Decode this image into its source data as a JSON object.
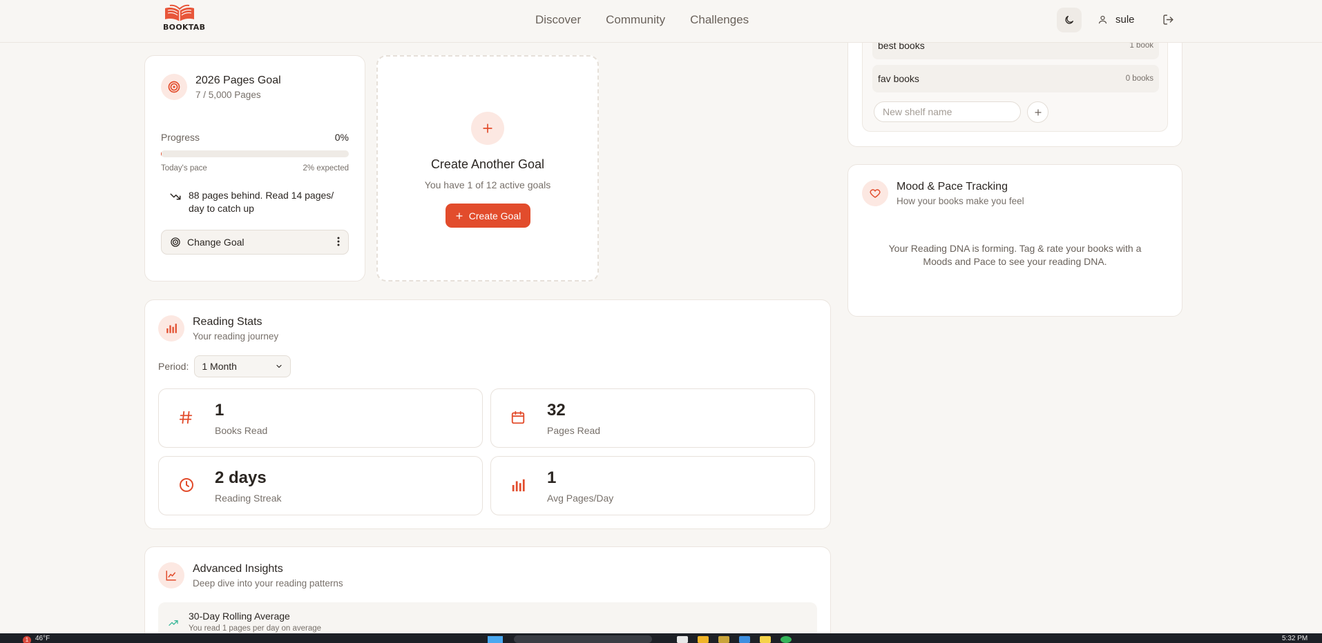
{
  "app": {
    "name": "BOOKTAB"
  },
  "header": {
    "nav": [
      "Discover",
      "Community",
      "Challenges"
    ],
    "username": "sule"
  },
  "goal": {
    "title": "2026 Pages Goal",
    "progress_text": "7 / 5,000 Pages",
    "progress_label": "Progress",
    "progress_percent_text": "0%",
    "progress_fraction": 0.0014,
    "pace_label": "Today's pace",
    "expected_text": "2% expected",
    "behind_text": "88 pages behind. Read 14 pages/ day to catch up",
    "change_button": "Change Goal"
  },
  "create_goal": {
    "title": "Create Another Goal",
    "subtitle": "You have 1 of 12 active goals",
    "button": "Create Goal"
  },
  "reading_stats": {
    "title": "Reading Stats",
    "subtitle": "Your reading journey",
    "period_label": "Period:",
    "period_value": "1 Month",
    "stats": [
      {
        "value": "1",
        "label": "Books Read",
        "icon": "hash-icon"
      },
      {
        "value": "32",
        "label": "Pages Read",
        "icon": "calendar-icon"
      },
      {
        "value": "2 days",
        "label": "Reading Streak",
        "icon": "clock-icon"
      },
      {
        "value": "1",
        "label": "Avg Pages/Day",
        "icon": "bar-chart-icon"
      }
    ]
  },
  "advanced": {
    "title": "Advanced Insights",
    "subtitle": "Deep dive into your reading patterns",
    "rolling_title": "30-Day Rolling Average",
    "rolling_sub": "You read 1 pages per day on average"
  },
  "shelves": {
    "items": [
      {
        "name": "best books",
        "count": "1 book"
      },
      {
        "name": "fav books",
        "count": "0 books"
      }
    ],
    "input_placeholder": "New shelf name"
  },
  "mood": {
    "title": "Mood & Pace Tracking",
    "subtitle": "How your books make you feel",
    "message": "Your Reading DNA is forming. Tag & rate your books with a Moods and Pace to see your reading DNA."
  },
  "taskbar": {
    "badge": "1",
    "temp": "46°F",
    "clock": "5:32 PM"
  },
  "colors": {
    "accent": "#e24c2c",
    "accent_soft": "#fce8e2",
    "background": "#f8f6f3"
  }
}
